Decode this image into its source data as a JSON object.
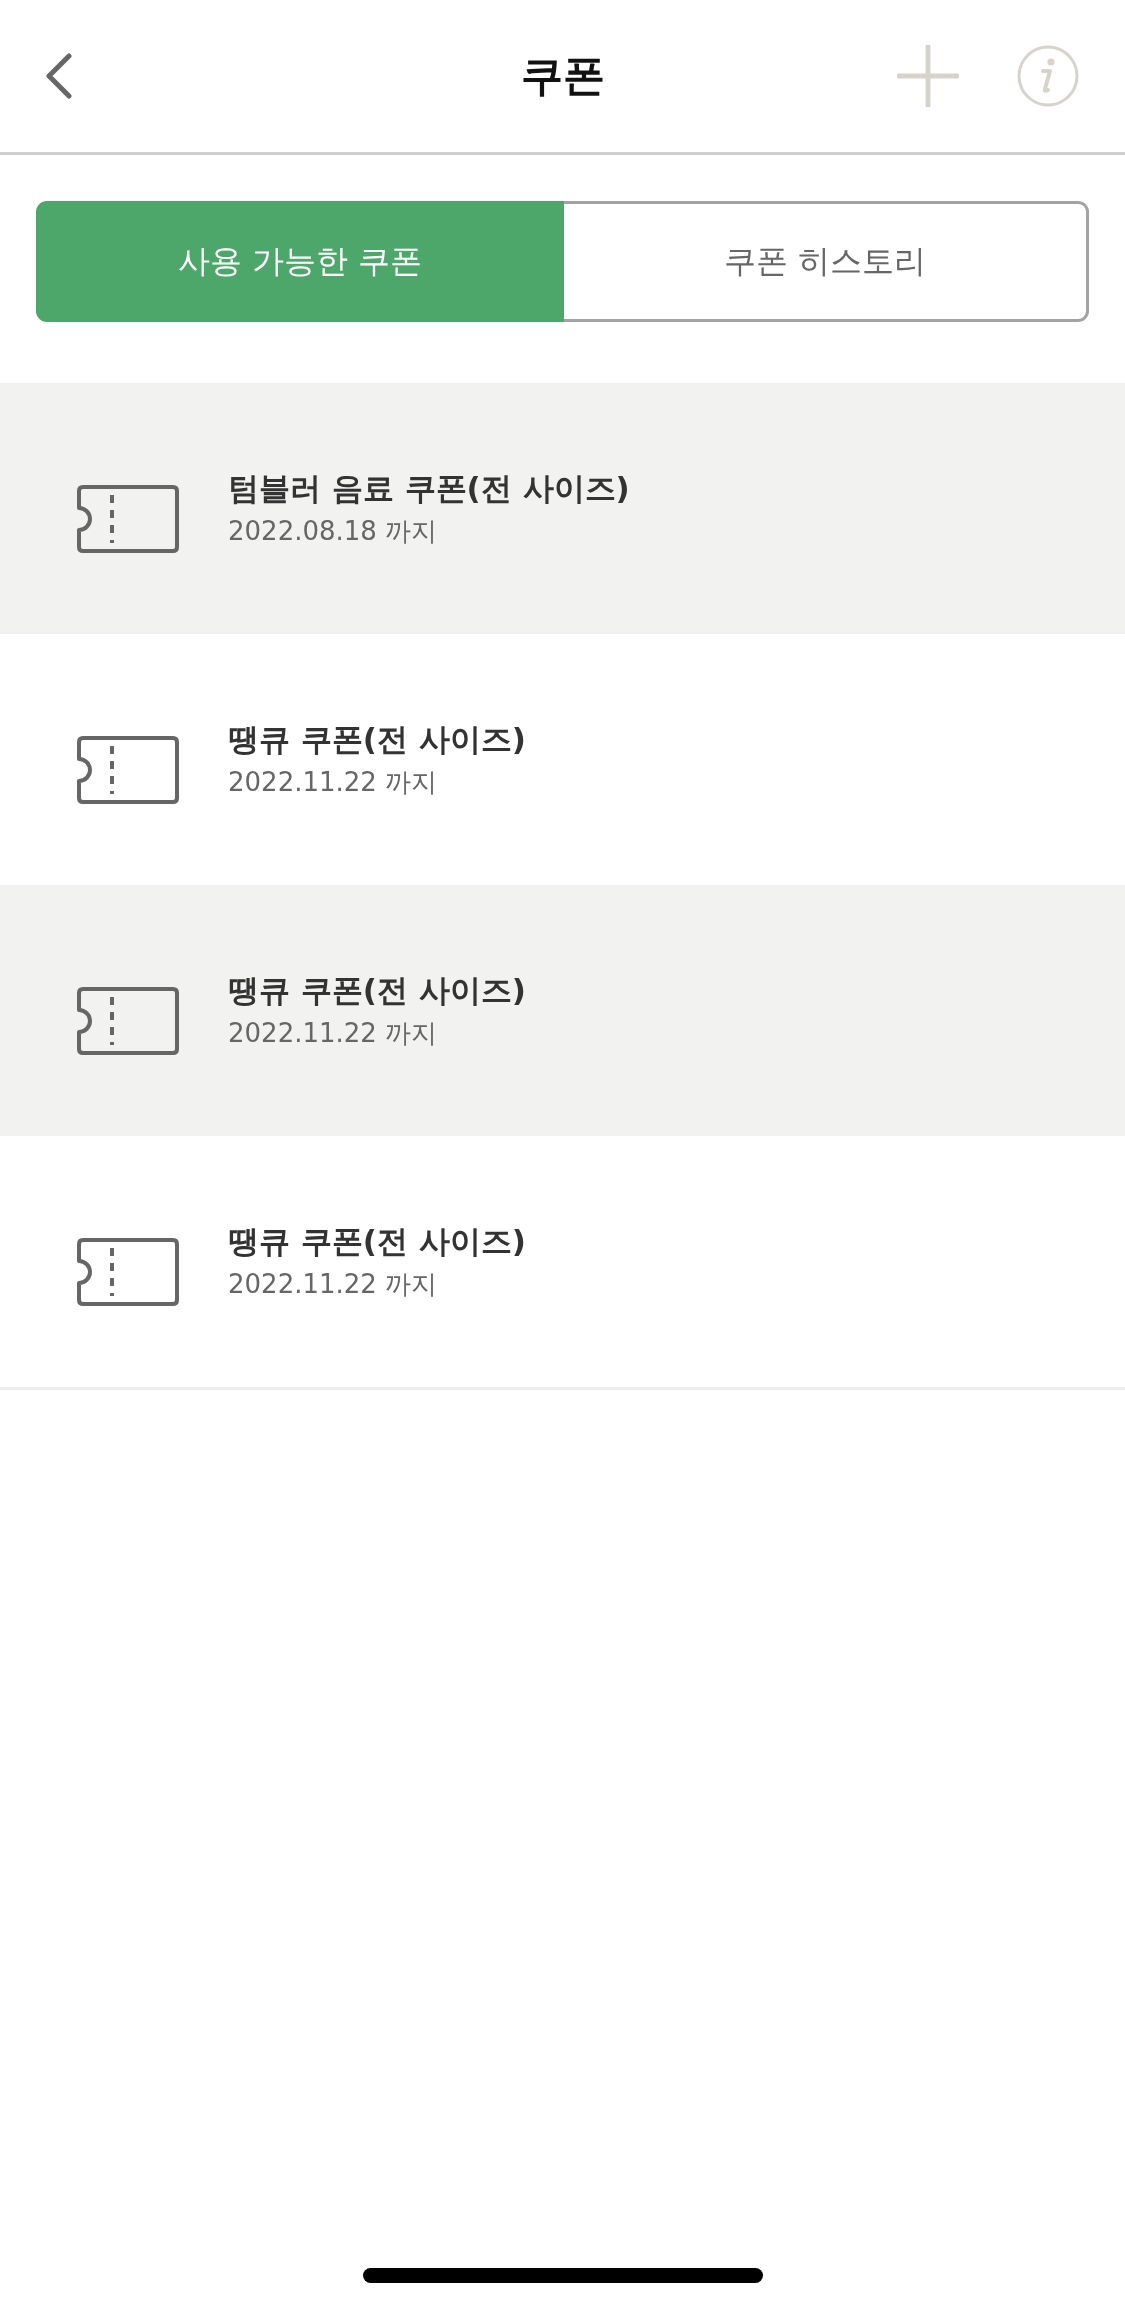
{
  "header": {
    "title": "쿠폰"
  },
  "tabs": [
    {
      "label": "사용 가능한 쿠폰",
      "selected": true
    },
    {
      "label": "쿠폰 히스토리",
      "selected": false
    }
  ],
  "coupons": [
    {
      "name": "텀블러 음료 쿠폰(전 사이즈)",
      "expiry": "2022.08.18 까지"
    },
    {
      "name": "땡큐 쿠폰(전 사이즈)",
      "expiry": "2022.11.22 까지"
    },
    {
      "name": "땡큐 쿠폰(전 사이즈)",
      "expiry": "2022.11.22 까지"
    },
    {
      "name": "땡큐 쿠폰(전 사이즈)",
      "expiry": "2022.11.22 까지"
    }
  ]
}
